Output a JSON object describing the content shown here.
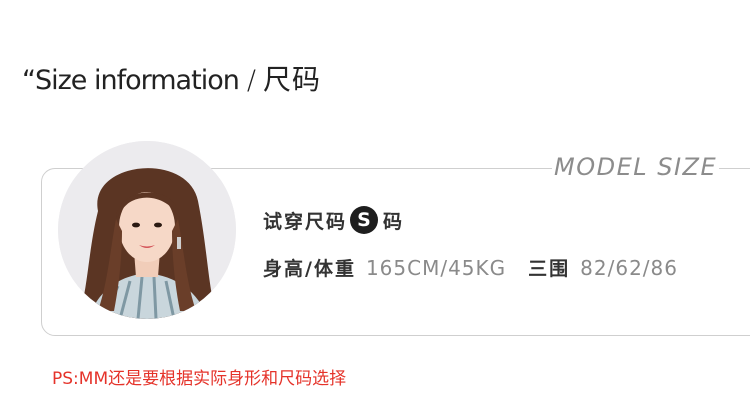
{
  "heading": {
    "en": "“Size information",
    "slash": "/",
    "cn": "尺码"
  },
  "card": {
    "model_size_label": "MODEL SIZE"
  },
  "trial": {
    "label": "试穿尺码",
    "size": "S",
    "suffix": "码"
  },
  "measurements": {
    "height_weight_label": "身高/体重",
    "height_weight_value": "165CM/45KG",
    "bust_waist_hip_label": "三围",
    "bust_waist_hip_value": "82/62/86"
  },
  "note": {
    "prefix": "PS:",
    "text": "MM还是要根据实际身形和尺码选择"
  },
  "colors": {
    "accent_red": "#e5332a",
    "text_dark": "#333333",
    "text_gray": "#8a8a8a",
    "border": "#cfcfcf",
    "badge_bg": "#1e1e1e"
  }
}
